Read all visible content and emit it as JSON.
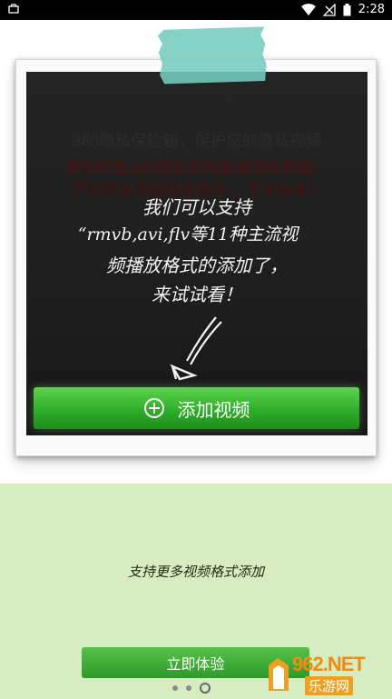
{
  "status_bar": {
    "time": "2:28",
    "icons": [
      "notification-icon",
      "wifi-icon",
      "signal-icon",
      "battery-icon"
    ]
  },
  "promo": {
    "hidden_lines": [
      "360隐私保险箱，保护您的隐私视频",
      "请勿卸载360隐私保险箱或清除数据，",
      "否则隐私视频将会丢失，无法恢复！"
    ],
    "script_lines": [
      "我们可以支持",
      "“rmvb,avi,flv等11种主流视",
      "频播放格式的添加了，",
      "来试试看！"
    ],
    "add_button_label": "添加视频"
  },
  "intro": {
    "caption": "支持更多视频格式添加",
    "cta_label": "立即体验",
    "page_count": 3,
    "active_page": 3
  },
  "watermark": {
    "brand": "962.NET",
    "sub": "乐游网"
  },
  "colors": {
    "accent_green": "#2fae2a",
    "lower_bg": "#d7edc1",
    "tape": "#76ccbe"
  }
}
